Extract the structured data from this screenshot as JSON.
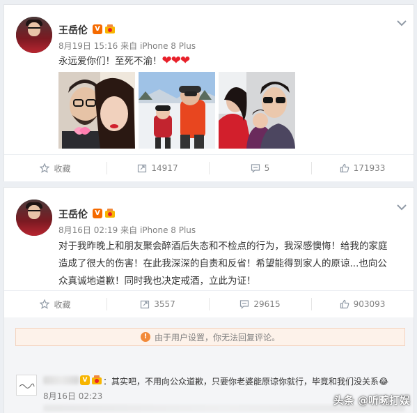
{
  "posts": [
    {
      "author": "王岳伦",
      "verified_badge": "V",
      "fan_icon": "fan-badge-icon",
      "time": "8月19日 15:16",
      "source": "来自 iPhone 8 Plus",
      "text": "永远爱你们！至死不渝！",
      "emoji": "❤❤❤",
      "photos": [
        "photo-couple-selfie",
        "photo-ski-family",
        "photo-family-car"
      ],
      "actions": {
        "favorite": "收藏",
        "forward": "14917",
        "comment": "5",
        "like": "171933"
      }
    },
    {
      "author": "王岳伦",
      "verified_badge": "V",
      "fan_icon": "fan-badge-icon",
      "time": "8月16日 02:19",
      "source": "来自 iPhone 8 Plus",
      "text_lines": [
        "对于我昨晚上和朋友聚会醉酒后失态和不检点的行为，我深感懊悔！给我的家庭",
        "造成了很大的伤害！在此我深深的自责和反省！希望能得到家人的原谅...也向公",
        "众真诚地道歉！同时我也决定戒酒，立此为证！"
      ],
      "actions": {
        "favorite": "收藏",
        "forward": "3557",
        "comment": "29615",
        "like": "903093"
      }
    }
  ],
  "notice": "由于用户设置，你无法回复评论。",
  "comment": {
    "text": "：其实吧，不用向公众道歉，只要你老婆能原谅你就行，毕竟和我们没关系",
    "time": "8月16日 02:23",
    "emoji": "😂"
  },
  "watermark": "头条 @听畹打娱",
  "colors": {
    "accent": "#f56a00",
    "heart": "#e8202a",
    "notice_bg": "#fdf2ea"
  }
}
